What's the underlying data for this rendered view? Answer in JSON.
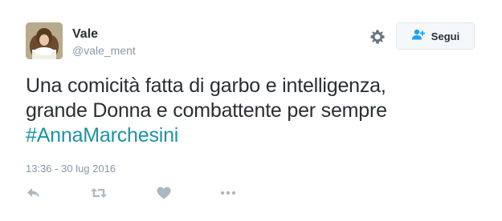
{
  "author": {
    "display_name": "Vale",
    "handle": "@vale_ment"
  },
  "follow_button": {
    "label": "Segui",
    "icon": "add-user-icon"
  },
  "settings": {
    "icon": "gear-icon"
  },
  "tweet": {
    "line1": "Una comicità fatta di garbo e intelligenza,",
    "line2": "grande Donna e combattente per sempre",
    "hashtag": "#AnnaMarchesini"
  },
  "timestamp": "13:36 - 30 lug 2016",
  "actions": [
    {
      "name": "reply",
      "icon": "reply-icon"
    },
    {
      "name": "retweet",
      "icon": "retweet-icon"
    },
    {
      "name": "like",
      "icon": "heart-icon"
    },
    {
      "name": "more",
      "icon": "more-icon"
    }
  ],
  "colors": {
    "text": "#292f33",
    "muted": "#8899a6",
    "hashtag": "#1b95a0",
    "action_icon": "#aab8c2",
    "follow_icon": "#1da1f2"
  }
}
